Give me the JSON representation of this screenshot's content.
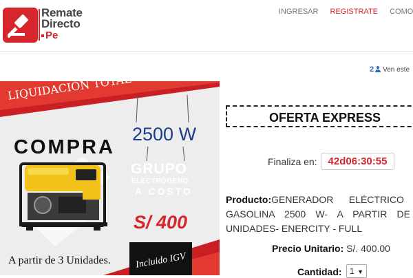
{
  "brand": {
    "line1": "Remate",
    "line2": "Directo",
    "line3": "Pe",
    "logo_icon": "gavel-icon",
    "accent": "#d7252c"
  },
  "nav": {
    "ingresar": "INGRESAR",
    "registrate": "REGISTRATE",
    "como": "COMO FU"
  },
  "viewers": {
    "count": "2",
    "icon": "user-icon",
    "text": "Ven este"
  },
  "promo": {
    "liquidacion": "LIQUIDACIÓN TOTAL",
    "compra": "COMPRA",
    "watts": "2500 W",
    "grupo": "GRUPO",
    "electrogeno": "ELECTRÓGENO",
    "a_costo": "A COSTO",
    "price": "S/ 400",
    "a_partir": "A partir de 3 Unidades.",
    "igv": "Incluido IGV"
  },
  "offer": {
    "title": "OFERTA EXPRESS",
    "finaliza_label": "Finaliza en:",
    "timer": "42d06:30:55",
    "product_label": "Producto:",
    "product_text": "GENERADOR ELÉCTRICO A GASOLINA 2500 W- A PARTIR DE 3 UNIDADES- ENERCITY - FULL",
    "price_label": "Precio Unitario:",
    "price_value": "S/. 400.00",
    "qty_label": "Cantidad:",
    "qty_value": "1"
  }
}
